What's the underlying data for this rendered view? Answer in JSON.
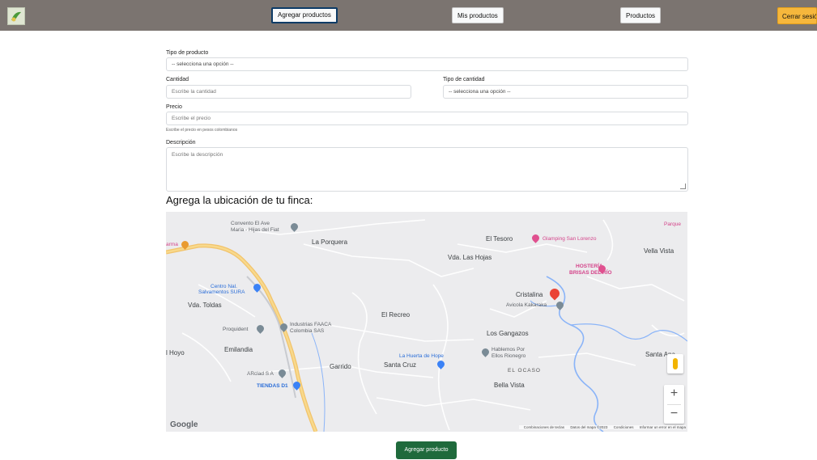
{
  "navbar": {
    "items": [
      {
        "label": "Agregar productos",
        "active": true
      },
      {
        "label": "Mis productos",
        "active": false
      },
      {
        "label": "Productos",
        "active": false
      }
    ],
    "logout_label": "Cerrar sesión"
  },
  "form": {
    "product_type": {
      "label": "Tipo de producto",
      "value": "-- selecciona una opción --"
    },
    "quantity": {
      "label": "Cantidad",
      "placeholder": "Escribe la cantidad"
    },
    "quantity_type": {
      "label": "Tipo de cantidad",
      "value": "-- selecciona una opción --"
    },
    "price": {
      "label": "Precio",
      "placeholder": "Escribe el precio",
      "help": "Escribe el precio en pesos colombianos"
    },
    "description": {
      "label": "Descripción",
      "placeholder": "Escribe la descripción"
    }
  },
  "location": {
    "title": "Agrega la ubicación de tu finca:"
  },
  "map": {
    "labels": {
      "convento": "Convento El Ave",
      "convento2": "Maria - Hijas del Fiat",
      "la_porquera": "La Porquera",
      "el_tesoro": "El Tesoro",
      "glamping": "Glamping San Lorenzo",
      "vella_vista": "Vella Vista",
      "parque": "Parque",
      "vda_las_hojas": "Vda. Las Hojas",
      "hosteria": "HOSTERÍA",
      "brisas": "BRISAS DEL RÍO",
      "centro": "Centro Nal.",
      "salvamentos": "Salvamentos SURA",
      "vda_toldas": "Vda. Toldas",
      "cristalina": "Cristalina",
      "avicola": "Avicola Kakaraka",
      "el_recreo": "El Recreo",
      "industrias": "Industrias FAACA",
      "colombia_sas": "Colombia SAS",
      "proquident": "Proquident",
      "los_gangazos": "Los Gangazos",
      "el_hoyo": "l Hoyo",
      "emilandia": "Emilandia",
      "hablemos": "Hablemos Por",
      "ellos": "Ellos Rionegro",
      "huerta": "La Huerta de Hope",
      "santa_cruz": "Santa Cruz",
      "garrido": "Garrido",
      "arclad": "ARclad S A",
      "el_ocaso": "EL OCASO",
      "tiendas": "TIENDAS D1",
      "bella_vista": "Bella Vista",
      "santa_ana": "Santa Ana",
      "arma": "arma",
      "google": "Google",
      "attrib_shortcuts": "Combinaciones de teclas",
      "attrib_data": "Datos del mapa ©2023",
      "attrib_terms": "Condiciones",
      "attrib_report": "Informar un error en el mapa",
      "zoom_in": "+",
      "zoom_out": "−"
    }
  },
  "submit_label": "Agregar producto"
}
